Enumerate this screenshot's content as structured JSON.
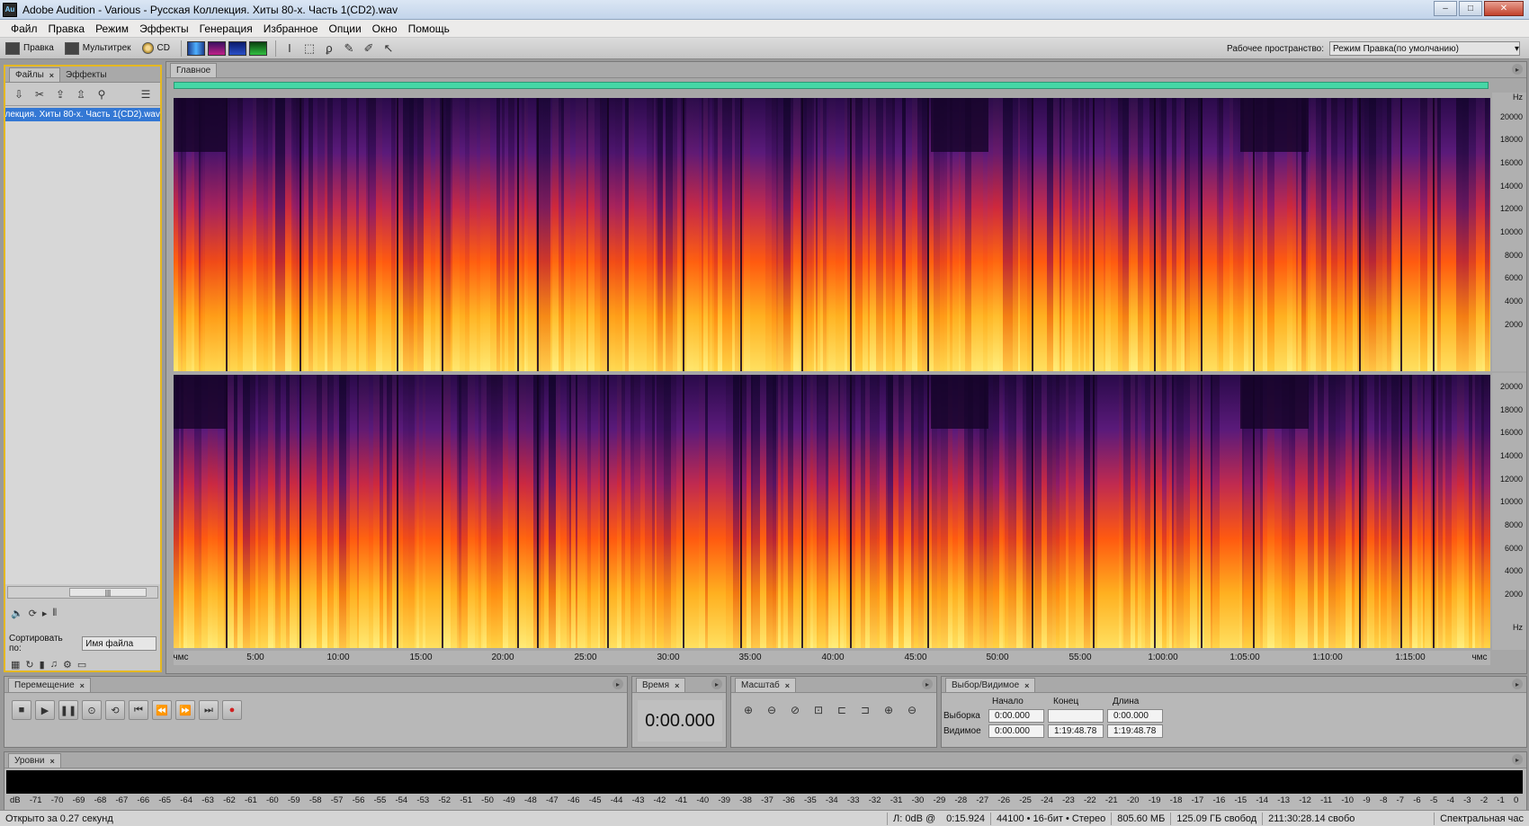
{
  "window": {
    "title": "Adobe Audition - Various - Русская Коллекция. Хиты 80-х. Часть 1(CD2).wav",
    "logo": "Au"
  },
  "menu": [
    "Файл",
    "Правка",
    "Режим",
    "Эффекты",
    "Генерация",
    "Избранное",
    "Опции",
    "Окно",
    "Помощь"
  ],
  "toolbar": {
    "edit": "Правка",
    "multitrack": "Мультитрек",
    "cd": "CD",
    "workspace_label": "Рабочее пространство:",
    "workspace_value": "Режим Правка(по умолчанию)"
  },
  "files_panel": {
    "tab_files": "Файлы",
    "tab_effects": "Эффекты",
    "file": "ллекция. Хиты 80-х. Часть 1(CD2).wav",
    "sort_label": "Сортировать по:",
    "sort_value": "Имя файла"
  },
  "main": {
    "tab": "Главное",
    "hz_unit": "Hz",
    "hz_labels": [
      "20000",
      "18000",
      "16000",
      "14000",
      "12000",
      "10000",
      "8000",
      "6000",
      "4000",
      "2000"
    ],
    "time_start": "чмс",
    "time_end": "чмс",
    "time_labels": [
      "5:00",
      "10:00",
      "15:00",
      "20:00",
      "25:00",
      "30:00",
      "35:00",
      "40:00",
      "45:00",
      "50:00",
      "55:00",
      "1:00:00",
      "1:05:00",
      "1:10:00",
      "1:15:00"
    ]
  },
  "transport": {
    "tab": "Перемещение"
  },
  "time": {
    "tab": "Время",
    "value": "0:00.000"
  },
  "zoom": {
    "tab": "Масштаб"
  },
  "selection": {
    "tab": "Выбор/Видимое",
    "col_start": "Начало",
    "col_end": "Конец",
    "col_length": "Длина",
    "row_selection": "Выборка",
    "row_view": "Видимое",
    "sel_start": "0:00.000",
    "sel_end": "",
    "sel_length": "0:00.000",
    "view_start": "0:00.000",
    "view_end": "1:19:48.78",
    "view_length": "1:19:48.78"
  },
  "levels": {
    "tab": "Уровни",
    "scale": [
      "dB",
      "-71",
      "-70",
      "-69",
      "-68",
      "-67",
      "-66",
      "-65",
      "-64",
      "-63",
      "-62",
      "-61",
      "-60",
      "-59",
      "-58",
      "-57",
      "-56",
      "-55",
      "-54",
      "-53",
      "-52",
      "-51",
      "-50",
      "-49",
      "-48",
      "-47",
      "-46",
      "-45",
      "-44",
      "-43",
      "-42",
      "-41",
      "-40",
      "-39",
      "-38",
      "-37",
      "-36",
      "-35",
      "-34",
      "-33",
      "-32",
      "-31",
      "-30",
      "-29",
      "-28",
      "-27",
      "-26",
      "-25",
      "-24",
      "-23",
      "-22",
      "-21",
      "-20",
      "-19",
      "-18",
      "-17",
      "-16",
      "-15",
      "-14",
      "-13",
      "-12",
      "-11",
      "-10",
      "-9",
      "-8",
      "-7",
      "-6",
      "-5",
      "-4",
      "-3",
      "-2",
      "-1",
      "0"
    ]
  },
  "status": {
    "opened": "Открыто за 0.27 секунд",
    "level": "Л: 0dB @",
    "position": "0:15.924",
    "format": "44100 • 16-бит • Стерео",
    "size": "805.60 МБ",
    "free": "125.09 ГБ свобод",
    "free_time": "211:30:28.14 свобо",
    "view": "Спектральная час"
  },
  "colors": {
    "accent_yellow": "#e5b822",
    "overview": "#46d7a6",
    "selection": "#3478d4"
  }
}
